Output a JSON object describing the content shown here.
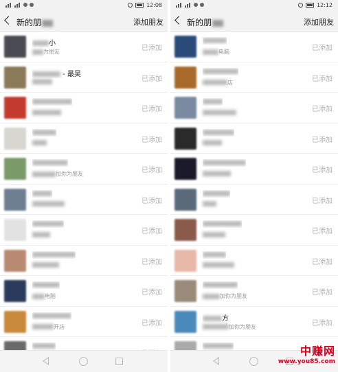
{
  "screens": [
    {
      "status": {
        "time": "12:08"
      },
      "nav": {
        "title": "新的朋",
        "action": "添加朋友"
      },
      "rows": [
        {
          "name": "小",
          "sub": "为朋友",
          "added": "已添加",
          "avatar_color": "#4a4a52"
        },
        {
          "name": " - 最吴",
          "sub": "",
          "added": "已添加",
          "avatar_color": "#8a7a5a"
        },
        {
          "name": "",
          "sub": "",
          "added": "已添加",
          "avatar_color": "#c33a2e"
        },
        {
          "name": "",
          "sub": "",
          "added": "已添加",
          "avatar_color": "#d8d6d0"
        },
        {
          "name": "",
          "sub": "加你为朋友",
          "added": "已添加",
          "avatar_color": "#7a9a6a"
        },
        {
          "name": "",
          "sub": "",
          "added": "已添加",
          "avatar_color": "#6c7e90"
        },
        {
          "name": "",
          "sub": "",
          "added": "已添加",
          "avatar_color": "#e2e2e2"
        },
        {
          "name": "",
          "sub": "",
          "added": "已添加",
          "avatar_color": "#b88a72"
        },
        {
          "name": "",
          "sub": "电脑",
          "added": "已添加",
          "avatar_color": "#2a3a5a"
        },
        {
          "name": "",
          "sub": "开店",
          "added": "已添加",
          "avatar_color": "#c88a3a"
        },
        {
          "name": "",
          "sub": "",
          "added": "已添加",
          "avatar_color": "#6a6a6a"
        }
      ],
      "system_nav": {
        "back": "back",
        "home": "home",
        "recent": "recent"
      }
    },
    {
      "status": {
        "time": "12:12"
      },
      "nav": {
        "title": "新的朋",
        "action": "添加朋友"
      },
      "rows": [
        {
          "name": "",
          "sub": "电脑",
          "added": "已添加",
          "avatar_color": "#2a4a7a"
        },
        {
          "name": "",
          "sub": "店",
          "added": "已添加",
          "avatar_color": "#a86a2a"
        },
        {
          "name": "",
          "sub": "",
          "added": "已添加",
          "avatar_color": "#7a8aa0"
        },
        {
          "name": "",
          "sub": "",
          "added": "已添加",
          "avatar_color": "#2a2a2a"
        },
        {
          "name": "",
          "sub": "",
          "added": "已添加",
          "avatar_color": "#1a1a2a"
        },
        {
          "name": "",
          "sub": "",
          "added": "已添加",
          "avatar_color": "#5a6a7a"
        },
        {
          "name": "",
          "sub": "",
          "added": "已添加",
          "avatar_color": "#8a5a4a"
        },
        {
          "name": "",
          "sub": "",
          "added": "已添加",
          "avatar_color": "#e8b8a8"
        },
        {
          "name": "",
          "sub": "加你为朋友",
          "added": "已添加",
          "avatar_color": "#9a8a7a"
        },
        {
          "name": "方",
          "sub": "加你为朋友",
          "added": "已添加",
          "avatar_color": "#4a8aba"
        },
        {
          "name": "",
          "sub": "",
          "added": "已添加",
          "avatar_color": "#aaaaaa"
        }
      ],
      "system_nav": {
        "back": "back",
        "home": "home",
        "recent": "recent"
      }
    }
  ],
  "watermark": {
    "logo": "中赚网",
    "url": "www.you85.com"
  }
}
